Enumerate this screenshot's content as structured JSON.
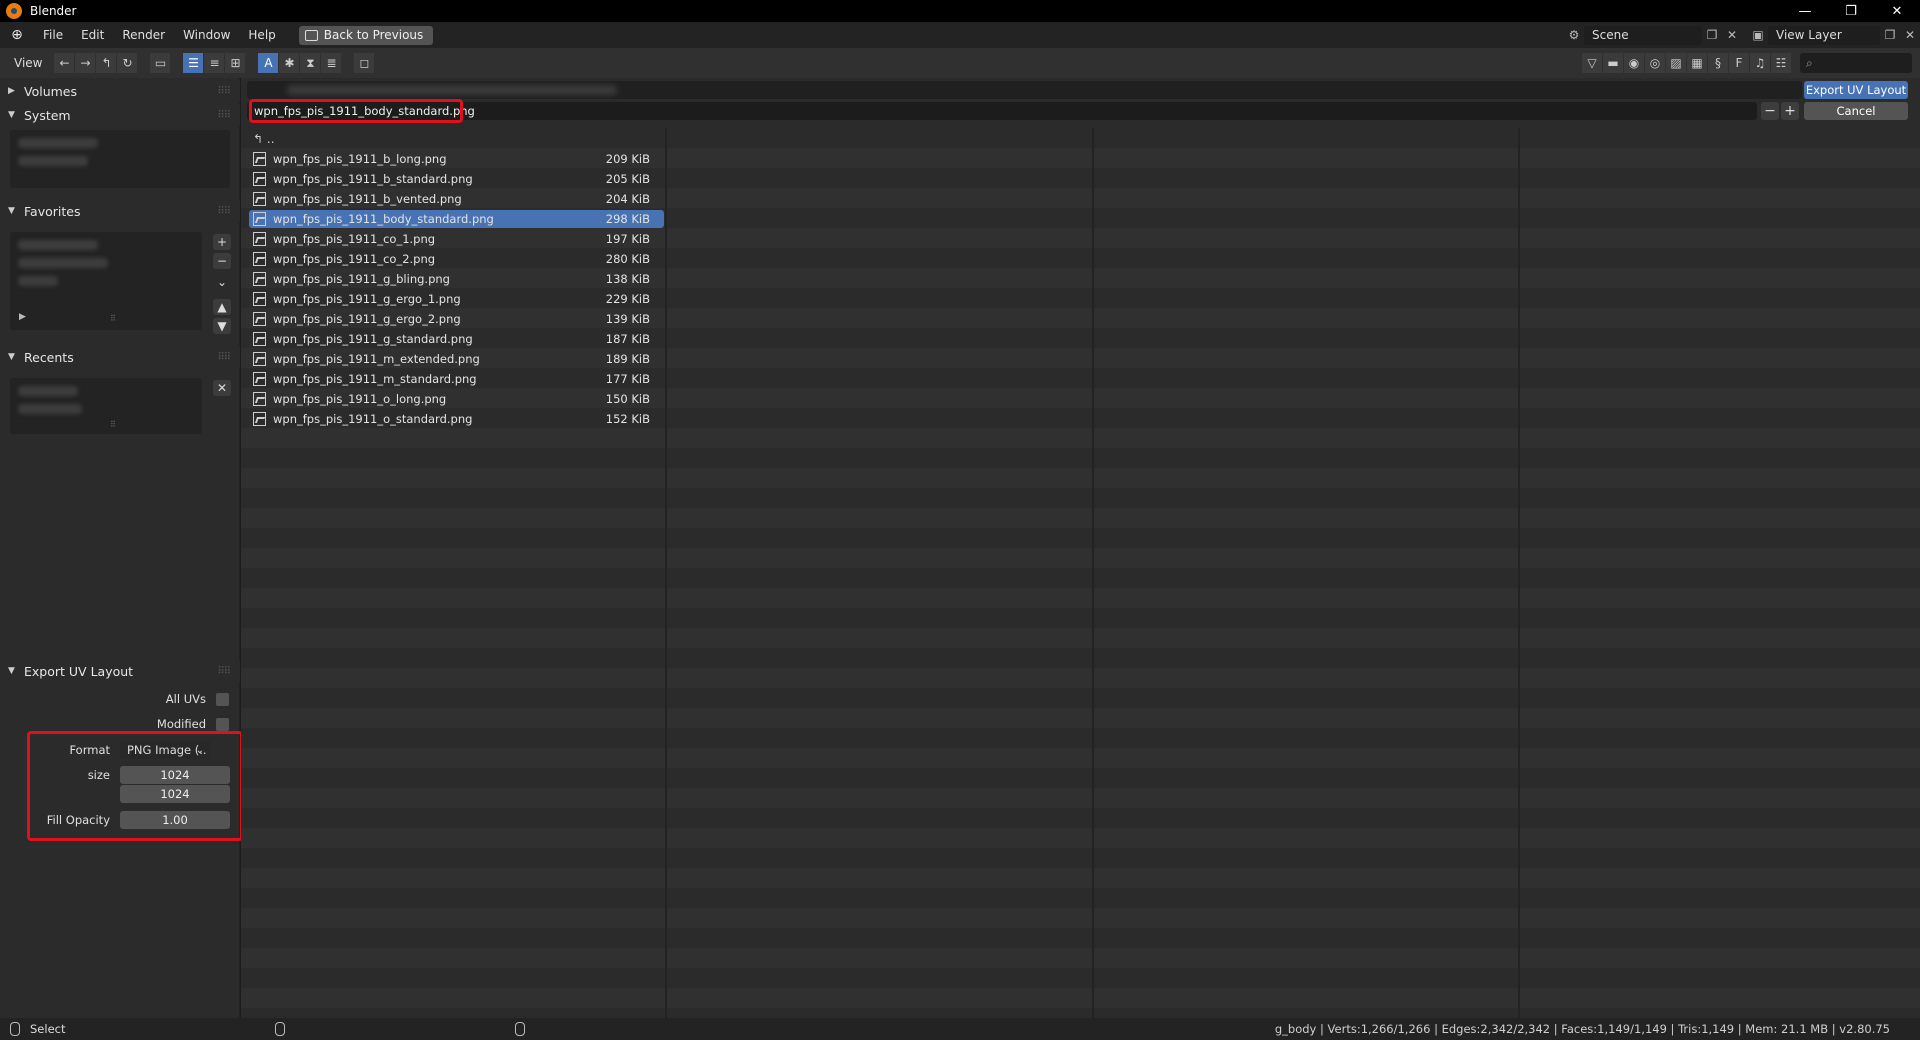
{
  "window": {
    "title": "Blender",
    "controls": [
      "—",
      "❐",
      "✕"
    ]
  },
  "menubar": {
    "items": [
      "File",
      "Edit",
      "Render",
      "Window",
      "Help"
    ],
    "back_button": "Back to Previous",
    "scene": "Scene",
    "view_layer": "View Layer"
  },
  "toolbar": {
    "view_label": "View"
  },
  "sidebar": {
    "volumes": "Volumes",
    "system": "System",
    "favorites": "Favorites",
    "recents": "Recents",
    "export_panel": {
      "title": "Export UV Layout",
      "all_uvs": "All UVs",
      "modified": "Modified",
      "format_label": "Format",
      "format_value": "PNG Image (..",
      "size_label": "size",
      "size_x": "1024",
      "size_y": "1024",
      "fill_opacity_label": "Fill Opacity",
      "fill_opacity": "1.00"
    }
  },
  "file_browser": {
    "filename": "wpn_fps_pis_1911_body_standard.png",
    "export_button": "Export UV Layout",
    "cancel_button": "Cancel",
    "parent_dir": "..",
    "files": [
      {
        "name": "wpn_fps_pis_1911_b_long.png",
        "size": "209 KiB",
        "selected": false
      },
      {
        "name": "wpn_fps_pis_1911_b_standard.png",
        "size": "205 KiB",
        "selected": false
      },
      {
        "name": "wpn_fps_pis_1911_b_vented.png",
        "size": "204 KiB",
        "selected": false
      },
      {
        "name": "wpn_fps_pis_1911_body_standard.png",
        "size": "298 KiB",
        "selected": true
      },
      {
        "name": "wpn_fps_pis_1911_co_1.png",
        "size": "197 KiB",
        "selected": false
      },
      {
        "name": "wpn_fps_pis_1911_co_2.png",
        "size": "280 KiB",
        "selected": false
      },
      {
        "name": "wpn_fps_pis_1911_g_bling.png",
        "size": "138 KiB",
        "selected": false
      },
      {
        "name": "wpn_fps_pis_1911_g_ergo_1.png",
        "size": "229 KiB",
        "selected": false
      },
      {
        "name": "wpn_fps_pis_1911_g_ergo_2.png",
        "size": "139 KiB",
        "selected": false
      },
      {
        "name": "wpn_fps_pis_1911_g_standard.png",
        "size": "187 KiB",
        "selected": false
      },
      {
        "name": "wpn_fps_pis_1911_m_extended.png",
        "size": "189 KiB",
        "selected": false
      },
      {
        "name": "wpn_fps_pis_1911_m_standard.png",
        "size": "177 KiB",
        "selected": false
      },
      {
        "name": "wpn_fps_pis_1911_o_long.png",
        "size": "150 KiB",
        "selected": false
      },
      {
        "name": "wpn_fps_pis_1911_o_standard.png",
        "size": "152 KiB",
        "selected": false
      }
    ]
  },
  "statusbar": {
    "select_label": "Select",
    "info": "g_body | Verts:1,266/1,266 | Edges:2,342/2,342 | Faces:1,149/1,149 | Tris:1,149 | Mem: 21.1 MB | v2.80.75"
  },
  "colors": {
    "accent": "#4772b3",
    "highlight": "#e0101c"
  }
}
